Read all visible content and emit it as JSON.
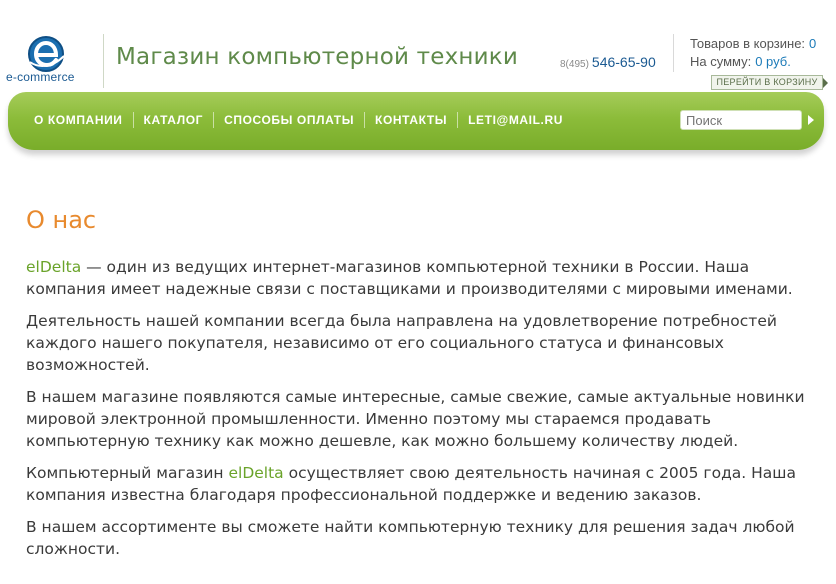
{
  "header": {
    "logo_text": "e-commerce",
    "site_title": "Магазин компьютерной техники",
    "phone_code": "8(495)",
    "phone_number": "546-65-90",
    "cart": {
      "items_label": "Товаров в корзине:",
      "items_value": "0",
      "sum_label": "На сумму:",
      "sum_value": "0 руб.",
      "button_label": "ПЕРЕЙТИ В КОРЗИНУ"
    }
  },
  "nav": {
    "items": [
      {
        "label": "О КОМПАНИИ"
      },
      {
        "label": "КАТАЛОГ"
      },
      {
        "label": "СПОСОБЫ ОПЛАТЫ"
      },
      {
        "label": "КОНТАКТЫ"
      },
      {
        "label": "LETI@MAIL.RU"
      }
    ],
    "search_placeholder": "Поиск"
  },
  "main": {
    "heading": "О нас",
    "p1_brand": "elDelta",
    "p1_text": " — один из ведущих интернет-магазинов компьютерной техники в России. Наша компания имеет надежные связи с поставщиками и производителями с мировыми именами.",
    "p2": "Деятельность нашей компании всегда была направлена на удовлетворение потребностей каждого нашего покупателя, независимо от его социального статуса и финансовых возможностей.",
    "p3": "В нашем магазине появляются самые интересные, самые свежие, самые актуальные новинки мировой электронной промышленности. Именно поэтому мы стараемся продавать компьютерную технику как можно дешевле, как можно большему количеству людей.",
    "p4_before": "Компьютерный магазин ",
    "p4_brand": "elDelta",
    "p4_after": " осуществляет свою деятельность начиная с 2005 года. Наша компания известна благодаря профессиональной поддержке и ведению заказов.",
    "p5": "В нашем ассортименте вы сможете найти компьютерную технику для решения задач любой сложности."
  },
  "colors": {
    "accent_green": "#79ad2a",
    "title_green": "#5f8a4a",
    "heading_orange": "#e88a2e",
    "link_blue": "#1b5a92"
  }
}
